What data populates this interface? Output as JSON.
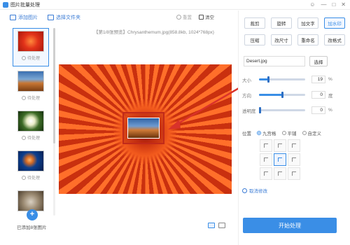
{
  "window": {
    "title": "图片批量处理",
    "controls": [
      "chat-icon",
      "minimize-icon",
      "maximize-icon",
      "close-icon"
    ]
  },
  "toolbar": {
    "add_images": "添加图片",
    "choose_folder": "选择文件夹"
  },
  "preview_header": {
    "restore": "重置",
    "clear": "清空"
  },
  "file_info": "【第1/8张预览】Chrysanthemum.jpg(858.8kb, 1024*768px)",
  "thumbnails": [
    {
      "status": "待处理",
      "image": "chrysanthemum"
    },
    {
      "status": "待处理",
      "image": "desert"
    },
    {
      "status": "待处理",
      "image": "hydrangeas"
    },
    {
      "status": "待处理",
      "image": "jellyfish"
    },
    {
      "status": "",
      "image": "koala"
    }
  ],
  "added_count_text": "已添加8张图片",
  "operations": [
    "裁剪",
    "旋转",
    "加文字",
    "加水印",
    "压缩",
    "改尺寸",
    "重命名",
    "改格式"
  ],
  "active_operation": "加水印",
  "watermark": {
    "file_name": "Desert.jpg",
    "choose_label": "选择",
    "size_label": "大小",
    "size_value": "19",
    "size_unit": "%",
    "size_level": 0.19,
    "direction_label": "方向",
    "direction_value": "0",
    "direction_unit": "度",
    "direction_level": 0.5,
    "opacity_label": "透明度",
    "opacity_value": "0",
    "opacity_unit": "%",
    "opacity_level": 0.0,
    "position_label": "位置",
    "position_options": [
      "九宫格",
      "平铺",
      "自定义"
    ],
    "position_selected": "九宫格",
    "grid_selected": "center",
    "restore_link": "取消修改"
  },
  "start_button": "开始处理",
  "colors": {
    "accent": "#3a8ee6",
    "arrow": "#d9322a"
  }
}
